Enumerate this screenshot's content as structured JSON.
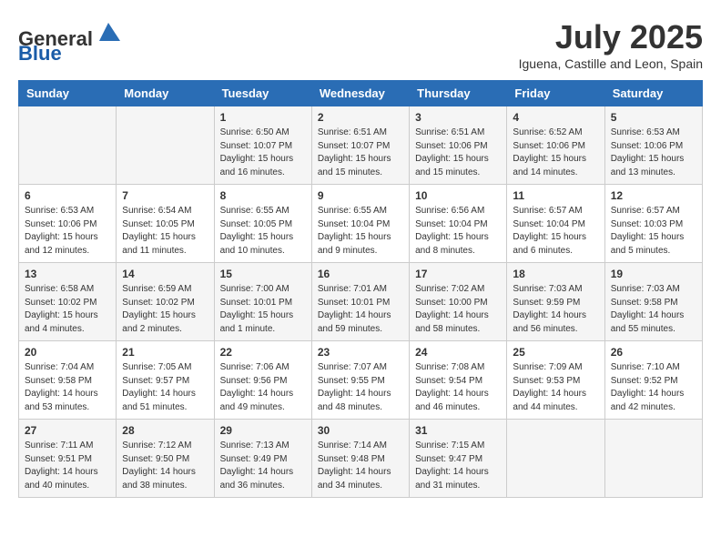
{
  "header": {
    "logo_general": "General",
    "logo_blue": "Blue",
    "month_title": "July 2025",
    "location": "Iguena, Castille and Leon, Spain"
  },
  "weekdays": [
    "Sunday",
    "Monday",
    "Tuesday",
    "Wednesday",
    "Thursday",
    "Friday",
    "Saturday"
  ],
  "weeks": [
    [
      {
        "day": "",
        "info": ""
      },
      {
        "day": "",
        "info": ""
      },
      {
        "day": "1",
        "info": "Sunrise: 6:50 AM\nSunset: 10:07 PM\nDaylight: 15 hours\nand 16 minutes."
      },
      {
        "day": "2",
        "info": "Sunrise: 6:51 AM\nSunset: 10:07 PM\nDaylight: 15 hours\nand 15 minutes."
      },
      {
        "day": "3",
        "info": "Sunrise: 6:51 AM\nSunset: 10:06 PM\nDaylight: 15 hours\nand 15 minutes."
      },
      {
        "day": "4",
        "info": "Sunrise: 6:52 AM\nSunset: 10:06 PM\nDaylight: 15 hours\nand 14 minutes."
      },
      {
        "day": "5",
        "info": "Sunrise: 6:53 AM\nSunset: 10:06 PM\nDaylight: 15 hours\nand 13 minutes."
      }
    ],
    [
      {
        "day": "6",
        "info": "Sunrise: 6:53 AM\nSunset: 10:06 PM\nDaylight: 15 hours\nand 12 minutes."
      },
      {
        "day": "7",
        "info": "Sunrise: 6:54 AM\nSunset: 10:05 PM\nDaylight: 15 hours\nand 11 minutes."
      },
      {
        "day": "8",
        "info": "Sunrise: 6:55 AM\nSunset: 10:05 PM\nDaylight: 15 hours\nand 10 minutes."
      },
      {
        "day": "9",
        "info": "Sunrise: 6:55 AM\nSunset: 10:04 PM\nDaylight: 15 hours\nand 9 minutes."
      },
      {
        "day": "10",
        "info": "Sunrise: 6:56 AM\nSunset: 10:04 PM\nDaylight: 15 hours\nand 8 minutes."
      },
      {
        "day": "11",
        "info": "Sunrise: 6:57 AM\nSunset: 10:04 PM\nDaylight: 15 hours\nand 6 minutes."
      },
      {
        "day": "12",
        "info": "Sunrise: 6:57 AM\nSunset: 10:03 PM\nDaylight: 15 hours\nand 5 minutes."
      }
    ],
    [
      {
        "day": "13",
        "info": "Sunrise: 6:58 AM\nSunset: 10:02 PM\nDaylight: 15 hours\nand 4 minutes."
      },
      {
        "day": "14",
        "info": "Sunrise: 6:59 AM\nSunset: 10:02 PM\nDaylight: 15 hours\nand 2 minutes."
      },
      {
        "day": "15",
        "info": "Sunrise: 7:00 AM\nSunset: 10:01 PM\nDaylight: 15 hours\nand 1 minute."
      },
      {
        "day": "16",
        "info": "Sunrise: 7:01 AM\nSunset: 10:01 PM\nDaylight: 14 hours\nand 59 minutes."
      },
      {
        "day": "17",
        "info": "Sunrise: 7:02 AM\nSunset: 10:00 PM\nDaylight: 14 hours\nand 58 minutes."
      },
      {
        "day": "18",
        "info": "Sunrise: 7:03 AM\nSunset: 9:59 PM\nDaylight: 14 hours\nand 56 minutes."
      },
      {
        "day": "19",
        "info": "Sunrise: 7:03 AM\nSunset: 9:58 PM\nDaylight: 14 hours\nand 55 minutes."
      }
    ],
    [
      {
        "day": "20",
        "info": "Sunrise: 7:04 AM\nSunset: 9:58 PM\nDaylight: 14 hours\nand 53 minutes."
      },
      {
        "day": "21",
        "info": "Sunrise: 7:05 AM\nSunset: 9:57 PM\nDaylight: 14 hours\nand 51 minutes."
      },
      {
        "day": "22",
        "info": "Sunrise: 7:06 AM\nSunset: 9:56 PM\nDaylight: 14 hours\nand 49 minutes."
      },
      {
        "day": "23",
        "info": "Sunrise: 7:07 AM\nSunset: 9:55 PM\nDaylight: 14 hours\nand 48 minutes."
      },
      {
        "day": "24",
        "info": "Sunrise: 7:08 AM\nSunset: 9:54 PM\nDaylight: 14 hours\nand 46 minutes."
      },
      {
        "day": "25",
        "info": "Sunrise: 7:09 AM\nSunset: 9:53 PM\nDaylight: 14 hours\nand 44 minutes."
      },
      {
        "day": "26",
        "info": "Sunrise: 7:10 AM\nSunset: 9:52 PM\nDaylight: 14 hours\nand 42 minutes."
      }
    ],
    [
      {
        "day": "27",
        "info": "Sunrise: 7:11 AM\nSunset: 9:51 PM\nDaylight: 14 hours\nand 40 minutes."
      },
      {
        "day": "28",
        "info": "Sunrise: 7:12 AM\nSunset: 9:50 PM\nDaylight: 14 hours\nand 38 minutes."
      },
      {
        "day": "29",
        "info": "Sunrise: 7:13 AM\nSunset: 9:49 PM\nDaylight: 14 hours\nand 36 minutes."
      },
      {
        "day": "30",
        "info": "Sunrise: 7:14 AM\nSunset: 9:48 PM\nDaylight: 14 hours\nand 34 minutes."
      },
      {
        "day": "31",
        "info": "Sunrise: 7:15 AM\nSunset: 9:47 PM\nDaylight: 14 hours\nand 31 minutes."
      },
      {
        "day": "",
        "info": ""
      },
      {
        "day": "",
        "info": ""
      }
    ]
  ]
}
